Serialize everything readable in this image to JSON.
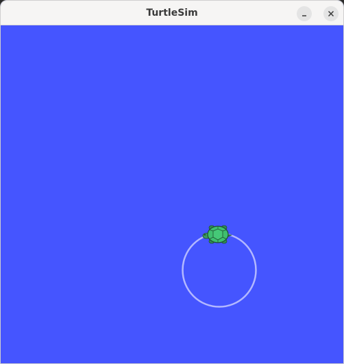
{
  "window": {
    "title": "TurtleSim",
    "background_color": "#4555ff",
    "buttons": [
      {
        "name": "minimize",
        "icon": "minimize-icon"
      },
      {
        "name": "close",
        "icon": "close-icon"
      }
    ]
  },
  "turtle": {
    "icon": "turtle-icon",
    "pen_color": "#b3b8ff",
    "shell_color": "#3fbf6f"
  }
}
